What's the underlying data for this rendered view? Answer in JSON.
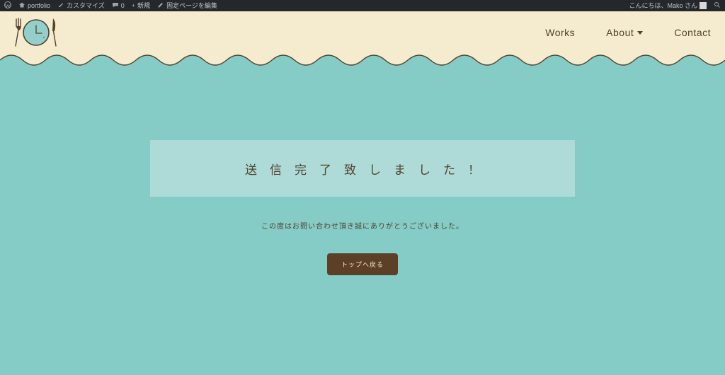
{
  "adminbar": {
    "wp_icon": "wordpress-icon",
    "site_name": "portfolio",
    "customize": "カスタマイズ",
    "comments_count": "0",
    "new": "新規",
    "edit_page": "固定ページを編集",
    "greeting": "こんにちは、Mako さん"
  },
  "nav": {
    "works": "Works",
    "about": "About",
    "contact": "Contact"
  },
  "main": {
    "heading": "送信完了致しました！",
    "thanks": "この度はお問い合わせ頂き誠にありがとうございました。",
    "back_btn": "トップへ戻る"
  },
  "colors": {
    "cream": "#f5ebce",
    "teal": "#85cbc6",
    "teal_light": "#aedbd7",
    "brown": "#5b3f26",
    "text_brown": "#51432c"
  }
}
